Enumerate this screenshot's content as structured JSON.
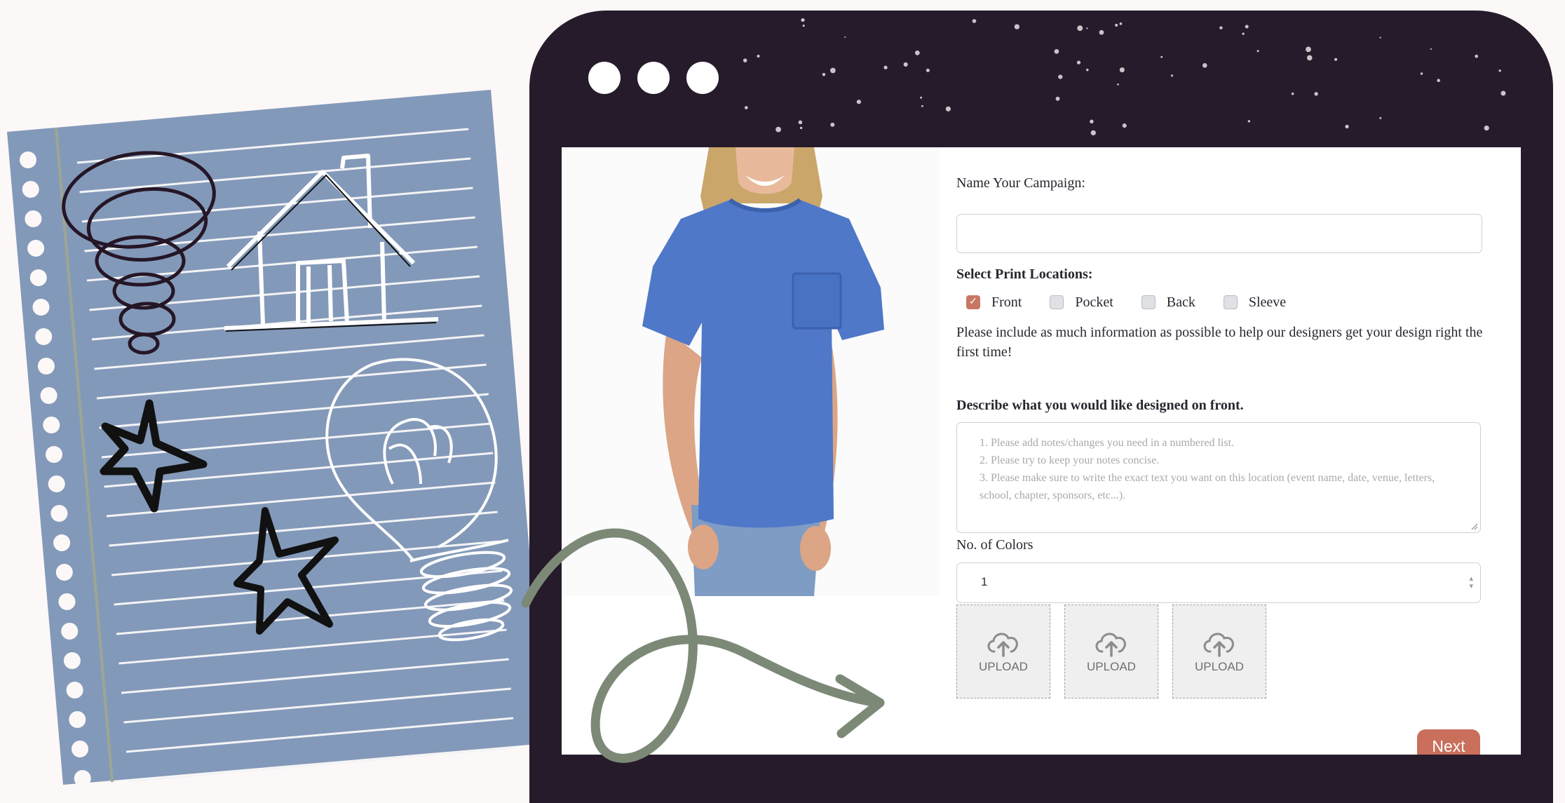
{
  "window": {
    "controls": [
      "dot",
      "dot",
      "dot"
    ]
  },
  "form": {
    "campaign_label": "Name Your Campaign:",
    "campaign_value": "",
    "locations_label": "Select Print Locations:",
    "locations": [
      {
        "label": "Front",
        "checked": true
      },
      {
        "label": "Pocket",
        "checked": false
      },
      {
        "label": "Back",
        "checked": false
      },
      {
        "label": "Sleeve",
        "checked": false
      }
    ],
    "help_text": "Please include as much information as possible to help our designers get your design right the first time!",
    "describe_label": "Describe what you would like designed on front.",
    "describe_placeholder_lines": [
      "1. Please add notes/changes you need in a numbered list.",
      "2. Please try to keep your notes concise.",
      "3. Please make sure to write the exact text you want on this location (event name, date, venue, letters, school, chapter, sponsors, etc...)."
    ],
    "colors_label": "No. of Colors",
    "colors_value": "1",
    "upload_label": "UPLOAD",
    "next_label": "Next"
  },
  "icons": [
    "notebook-sketch",
    "product-photo",
    "upload-cloud-icon",
    "curly-arrow"
  ],
  "colors": {
    "window": "#261b2a",
    "accent": "#c96f5b",
    "notebook": "#8399b9",
    "arrow": "#7c8977",
    "shirt": "#4f78c8"
  }
}
